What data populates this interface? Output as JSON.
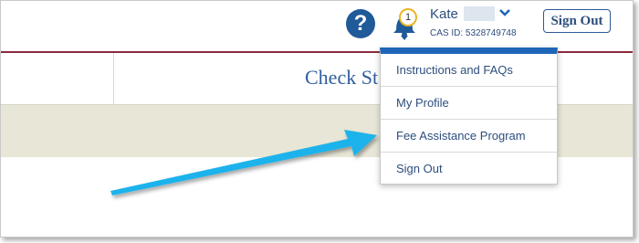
{
  "header": {
    "help_label": "?",
    "notification_count": "1",
    "user_name": "Kate",
    "cas_id": "CAS ID: 5328749748",
    "signout_label": "Sign Out"
  },
  "nav": {
    "title": "Check St"
  },
  "dropdown": {
    "items": [
      {
        "label": "Instructions and FAQs"
      },
      {
        "label": "My Profile"
      },
      {
        "label": "Fee Assistance Program"
      },
      {
        "label": "Sign Out"
      }
    ]
  },
  "colors": {
    "accent": "#1f66b6",
    "header_rule": "#8b2a3d",
    "arrow": "#1fb3ec",
    "band": "#e8e6d6"
  }
}
